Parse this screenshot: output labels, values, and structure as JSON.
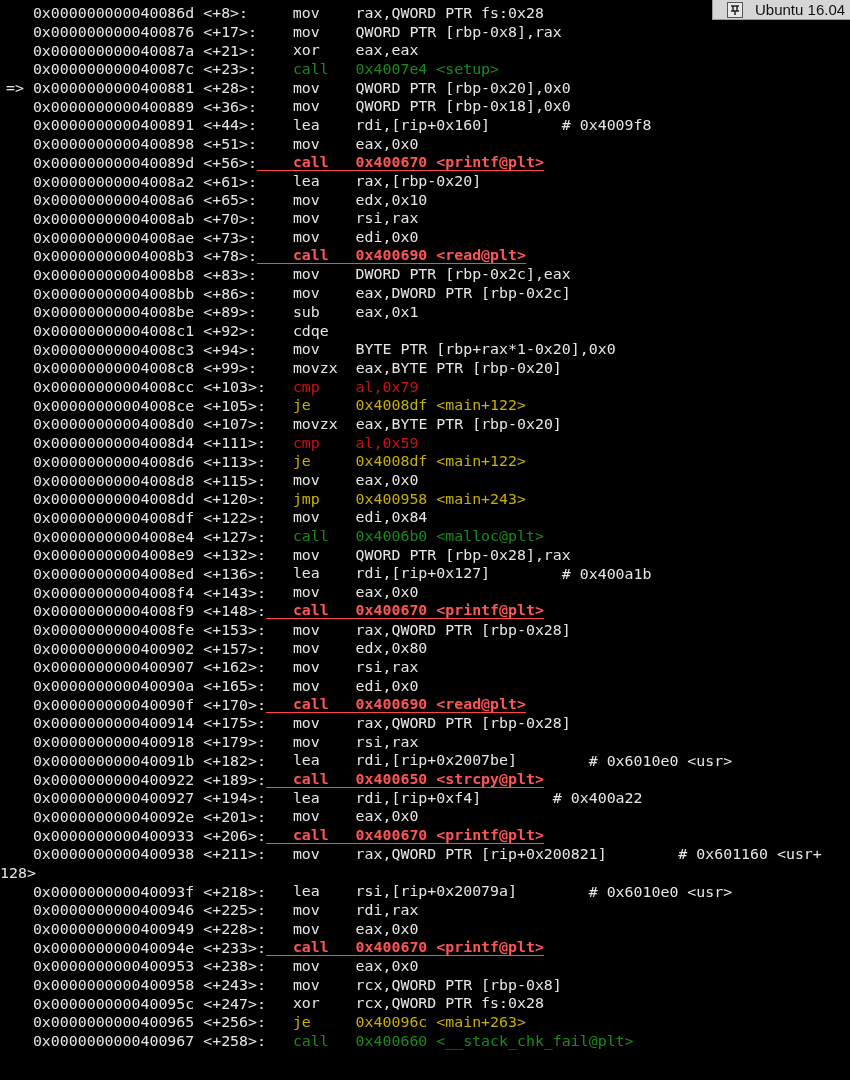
{
  "title_tab": {
    "label": "Ubuntu 16.04"
  },
  "rows": [
    {
      "address": "0x000000000040086d",
      "offset": "<+8>:",
      "kind": "plain",
      "mnemonic": "mov",
      "operands": "rax,QWORD PTR fs:0x28"
    },
    {
      "address": "0x0000000000400876",
      "offset": "<+17>:",
      "kind": "plain",
      "mnemonic": "mov",
      "operands": "QWORD PTR [rbp-0x8],rax"
    },
    {
      "address": "0x000000000040087a",
      "offset": "<+21>:",
      "kind": "plain",
      "mnemonic": "xor",
      "operands": "eax,eax"
    },
    {
      "address": "0x000000000040087c",
      "offset": "<+23>:",
      "kind": "call",
      "mnemonic": "call",
      "operands": "0x4007e4 <setup>"
    },
    {
      "marker": "=>",
      "address": "0x0000000000400881",
      "offset": "<+28>:",
      "kind": "plain",
      "mnemonic": "mov",
      "operands": "QWORD PTR [rbp-0x20],0x0"
    },
    {
      "address": "0x0000000000400889",
      "offset": "<+36>:",
      "kind": "plain",
      "mnemonic": "mov",
      "operands": "QWORD PTR [rbp-0x18],0x0"
    },
    {
      "address": "0x0000000000400891",
      "offset": "<+44>:",
      "kind": "plain",
      "mnemonic": "lea",
      "operands": "rdi,[rip+0x160]",
      "comment": "# 0x4009f8"
    },
    {
      "address": "0x0000000000400898",
      "offset": "<+51>:",
      "kind": "plain",
      "mnemonic": "mov",
      "operands": "eax,0x0"
    },
    {
      "address": "0x000000000040089d",
      "offset": "<+56>:",
      "kind": "highlight",
      "mnemonic": "call",
      "operands": "0x400670 <printf@plt>"
    },
    {
      "address": "0x00000000004008a2",
      "offset": "<+61>:",
      "kind": "plain",
      "mnemonic": "lea",
      "operands": "rax,[rbp-0x20]"
    },
    {
      "address": "0x00000000004008a6",
      "offset": "<+65>:",
      "kind": "plain",
      "mnemonic": "mov",
      "operands": "edx,0x10"
    },
    {
      "address": "0x00000000004008ab",
      "offset": "<+70>:",
      "kind": "plain",
      "mnemonic": "mov",
      "operands": "rsi,rax"
    },
    {
      "address": "0x00000000004008ae",
      "offset": "<+73>:",
      "kind": "plain",
      "mnemonic": "mov",
      "operands": "edi,0x0"
    },
    {
      "address": "0x00000000004008b3",
      "offset": "<+78>:",
      "kind": "highlight",
      "mnemonic": "call",
      "operands": "0x400690 <read@plt>"
    },
    {
      "address": "0x00000000004008b8",
      "offset": "<+83>:",
      "kind": "plain",
      "mnemonic": "mov",
      "operands": "DWORD PTR [rbp-0x2c],eax"
    },
    {
      "address": "0x00000000004008bb",
      "offset": "<+86>:",
      "kind": "plain",
      "mnemonic": "mov",
      "operands": "eax,DWORD PTR [rbp-0x2c]"
    },
    {
      "address": "0x00000000004008be",
      "offset": "<+89>:",
      "kind": "plain",
      "mnemonic": "sub",
      "operands": "eax,0x1"
    },
    {
      "address": "0x00000000004008c1",
      "offset": "<+92>:",
      "kind": "plain",
      "mnemonic": "cdqe"
    },
    {
      "address": "0x00000000004008c3",
      "offset": "<+94>:",
      "kind": "plain",
      "mnemonic": "mov",
      "operands": "BYTE PTR [rbp+rax*1-0x20],0x0"
    },
    {
      "address": "0x00000000004008c8",
      "offset": "<+99>:",
      "kind": "plain",
      "mnemonic": "movzx",
      "operands": "eax,BYTE PTR [rbp-0x20]"
    },
    {
      "address": "0x00000000004008cc",
      "offset": "<+103>:",
      "kind": "compare",
      "mnemonic": "cmp",
      "operands": "al,0x79"
    },
    {
      "address": "0x00000000004008ce",
      "offset": "<+105>:",
      "kind": "jump",
      "mnemonic": "je",
      "operands": "0x4008df <main+122>"
    },
    {
      "address": "0x00000000004008d0",
      "offset": "<+107>:",
      "kind": "plain",
      "mnemonic": "movzx",
      "operands": "eax,BYTE PTR [rbp-0x20]"
    },
    {
      "address": "0x00000000004008d4",
      "offset": "<+111>:",
      "kind": "compare",
      "mnemonic": "cmp",
      "operands": "al,0x59"
    },
    {
      "address": "0x00000000004008d6",
      "offset": "<+113>:",
      "kind": "jump",
      "mnemonic": "je",
      "operands": "0x4008df <main+122>"
    },
    {
      "address": "0x00000000004008d8",
      "offset": "<+115>:",
      "kind": "plain",
      "mnemonic": "mov",
      "operands": "eax,0x0"
    },
    {
      "address": "0x00000000004008dd",
      "offset": "<+120>:",
      "kind": "jump",
      "mnemonic": "jmp",
      "operands": "0x400958 <main+243>"
    },
    {
      "address": "0x00000000004008df",
      "offset": "<+122>:",
      "kind": "plain",
      "mnemonic": "mov",
      "operands": "edi,0x84"
    },
    {
      "address": "0x00000000004008e4",
      "offset": "<+127>:",
      "kind": "call",
      "mnemonic": "call",
      "operands": "0x4006b0 <malloc@plt>"
    },
    {
      "address": "0x00000000004008e9",
      "offset": "<+132>:",
      "kind": "plain",
      "mnemonic": "mov",
      "operands": "QWORD PTR [rbp-0x28],rax"
    },
    {
      "address": "0x00000000004008ed",
      "offset": "<+136>:",
      "kind": "plain",
      "mnemonic": "lea",
      "operands": "rdi,[rip+0x127]",
      "comment": "# 0x400a1b"
    },
    {
      "address": "0x00000000004008f4",
      "offset": "<+143>:",
      "kind": "plain",
      "mnemonic": "mov",
      "operands": "eax,0x0"
    },
    {
      "address": "0x00000000004008f9",
      "offset": "<+148>:",
      "kind": "highlight",
      "mnemonic": "call",
      "operands": "0x400670 <printf@plt>"
    },
    {
      "address": "0x00000000004008fe",
      "offset": "<+153>:",
      "kind": "plain",
      "mnemonic": "mov",
      "operands": "rax,QWORD PTR [rbp-0x28]"
    },
    {
      "address": "0x0000000000400902",
      "offset": "<+157>:",
      "kind": "plain",
      "mnemonic": "mov",
      "operands": "edx,0x80"
    },
    {
      "address": "0x0000000000400907",
      "offset": "<+162>:",
      "kind": "plain",
      "mnemonic": "mov",
      "operands": "rsi,rax"
    },
    {
      "address": "0x000000000040090a",
      "offset": "<+165>:",
      "kind": "plain",
      "mnemonic": "mov",
      "operands": "edi,0x0"
    },
    {
      "address": "0x000000000040090f",
      "offset": "<+170>:",
      "kind": "highlight",
      "mnemonic": "call",
      "operands": "0x400690 <read@plt>"
    },
    {
      "address": "0x0000000000400914",
      "offset": "<+175>:",
      "kind": "plain",
      "mnemonic": "mov",
      "operands": "rax,QWORD PTR [rbp-0x28]"
    },
    {
      "address": "0x0000000000400918",
      "offset": "<+179>:",
      "kind": "plain",
      "mnemonic": "mov",
      "operands": "rsi,rax"
    },
    {
      "address": "0x000000000040091b",
      "offset": "<+182>:",
      "kind": "plain",
      "mnemonic": "lea",
      "operands": "rdi,[rip+0x2007be]",
      "comment": "# 0x6010e0 <usr>"
    },
    {
      "address": "0x0000000000400922",
      "offset": "<+189>:",
      "kind": "highlight",
      "mnemonic": "call",
      "operands": "0x400650 <strcpy@plt>"
    },
    {
      "address": "0x0000000000400927",
      "offset": "<+194>:",
      "kind": "plain",
      "mnemonic": "lea",
      "operands": "rdi,[rip+0xf4]",
      "comment": "# 0x400a22"
    },
    {
      "address": "0x000000000040092e",
      "offset": "<+201>:",
      "kind": "plain",
      "mnemonic": "mov",
      "operands": "eax,0x0"
    },
    {
      "address": "0x0000000000400933",
      "offset": "<+206>:",
      "kind": "highlight",
      "mnemonic": "call",
      "operands": "0x400670 <printf@plt>"
    },
    {
      "address": "0x0000000000400938",
      "offset": "<+211>:",
      "kind": "plain",
      "mnemonic": "mov",
      "operands": "rax,QWORD PTR [rip+0x200821]",
      "comment": "# 0x601160 <usr+",
      "comment_wrap": "128>"
    },
    {
      "address": "0x000000000040093f",
      "offset": "<+218>:",
      "kind": "plain",
      "mnemonic": "lea",
      "operands": "rsi,[rip+0x20079a]",
      "comment": "# 0x6010e0 <usr>"
    },
    {
      "address": "0x0000000000400946",
      "offset": "<+225>:",
      "kind": "plain",
      "mnemonic": "mov",
      "operands": "rdi,rax"
    },
    {
      "address": "0x0000000000400949",
      "offset": "<+228>:",
      "kind": "plain",
      "mnemonic": "mov",
      "operands": "eax,0x0"
    },
    {
      "address": "0x000000000040094e",
      "offset": "<+233>:",
      "kind": "highlight",
      "mnemonic": "call",
      "operands": "0x400670 <printf@plt>"
    },
    {
      "address": "0x0000000000400953",
      "offset": "<+238>:",
      "kind": "plain",
      "mnemonic": "mov",
      "operands": "eax,0x0"
    },
    {
      "address": "0x0000000000400958",
      "offset": "<+243>:",
      "kind": "plain",
      "mnemonic": "mov",
      "operands": "rcx,QWORD PTR [rbp-0x8]"
    },
    {
      "address": "0x000000000040095c",
      "offset": "<+247>:",
      "kind": "plain",
      "mnemonic": "xor",
      "operands": "rcx,QWORD PTR fs:0x28"
    },
    {
      "address": "0x0000000000400965",
      "offset": "<+256>:",
      "kind": "jump",
      "mnemonic": "je",
      "operands": "0x40096c <main+263>"
    },
    {
      "address": "0x0000000000400967",
      "offset": "<+258>:",
      "kind": "call",
      "mnemonic": "call",
      "operands": "0x400660 <__stack_chk_fail@plt>"
    }
  ]
}
